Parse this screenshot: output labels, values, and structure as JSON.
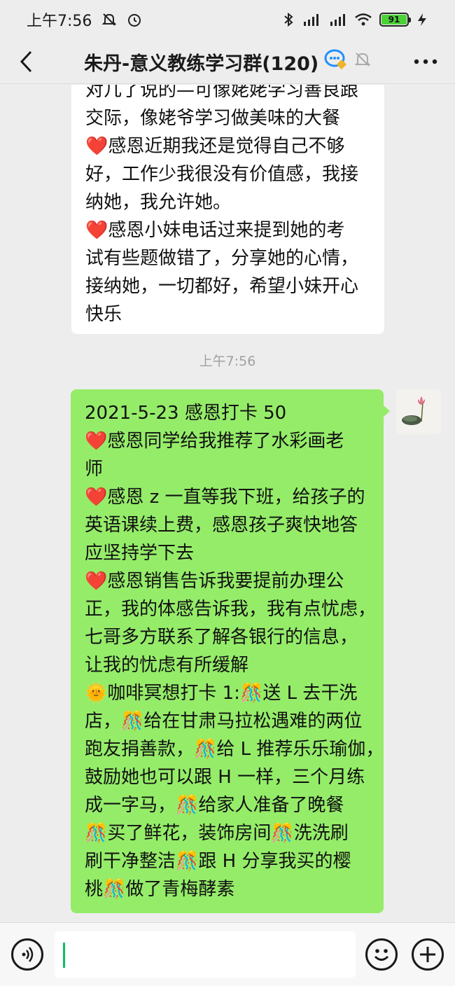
{
  "status_bar": {
    "time": "上午7:56",
    "battery": "91",
    "icons": [
      "mute-bell-icon",
      "alarm-icon",
      "bluetooth-icon",
      "hd-signal-icon",
      "signal-icon",
      "wifi-icon",
      "battery-icon",
      "charging-icon"
    ]
  },
  "nav": {
    "title": "朱丹-意义教练学习群(120)",
    "back_icon": "chevron-left-icon",
    "more_icon": "more-dots-icon",
    "extra_icons": [
      "chat-bubble-icon",
      "mute-bell-icon"
    ]
  },
  "messages": [
    {
      "side": "left",
      "lines": [
        "对几了说的—可像姥姥学习善良跟",
        "交际，像姥爷学习做美味的大餐",
        "❤️感恩近期我还是觉得自己不够",
        "好，工作少我很没有价值感，我接",
        "纳她，我允许她。",
        "❤️感恩小妹电话过来提到她的考",
        "试有些题做错了，分享她的心情，",
        "接纳她，一切都好，希望小妹开心",
        "快乐"
      ]
    },
    {
      "side": "time",
      "text": "上午7:56"
    },
    {
      "side": "right",
      "lines": [
        "2021-5-23 感恩打卡 50",
        "❤️感恩同学给我推荐了水彩画老",
        "师",
        "❤️感恩 z 一直等我下班，给孩子的",
        "英语课续上费，感恩孩子爽快地答",
        "应坚持学下去",
        "❤️感恩销售告诉我要提前办理公",
        "正，我的体感告诉我，我有点忧虑，",
        "七哥多方联系了解各银行的信息，",
        "让我的忧虑有所缓解",
        "🌞咖啡冥想打卡 1:🎊送 L 去干洗",
        "店，🎊给在甘肃马拉松遇难的两位",
        "跑友捐善款，🎊给 L 推荐乐乐瑜伽，",
        "鼓励她也可以跟 H 一样，三个月练",
        "成一字马，🎊给家人准备了晚餐",
        "🎊买了鲜花，装饰房间🎊洗洗刷",
        "刷干净整洁🎊跟 H 分享我买的樱",
        "桃🎊做了青梅酵素"
      ]
    }
  ],
  "input_bar": {
    "placeholder": "",
    "icons": [
      "voice-icon",
      "emoji-icon",
      "plus-icon"
    ]
  },
  "colors": {
    "background": "#ededed",
    "sent_bubble": "#95ec69",
    "received_bubble": "#ffffff",
    "caret": "#07c160"
  }
}
